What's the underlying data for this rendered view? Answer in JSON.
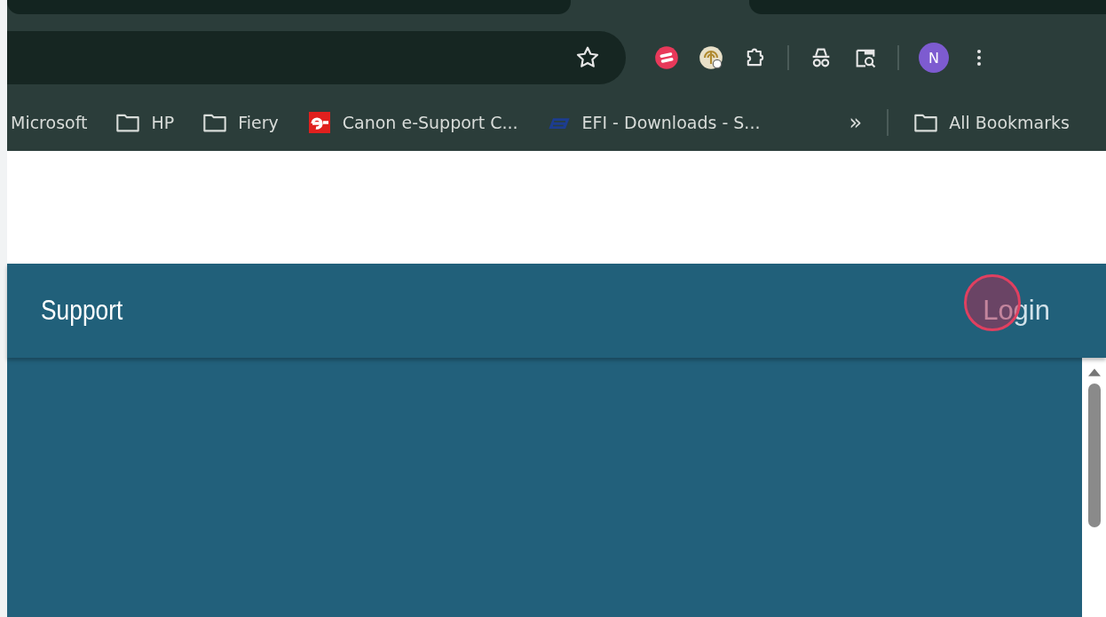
{
  "browser": {
    "profile_initial": "N",
    "bookmarks": [
      {
        "label": "Microsoft",
        "kind": "plain"
      },
      {
        "label": "HP",
        "kind": "folder"
      },
      {
        "label": "Fiery",
        "kind": "folder"
      },
      {
        "label": "Canon e-Support C...",
        "kind": "canon"
      },
      {
        "label": "EFI - Downloads - S...",
        "kind": "efi"
      }
    ],
    "overflow": "»",
    "all_bookmarks": "All Bookmarks"
  },
  "app_bar": {
    "title": "Support",
    "login": "Login"
  }
}
